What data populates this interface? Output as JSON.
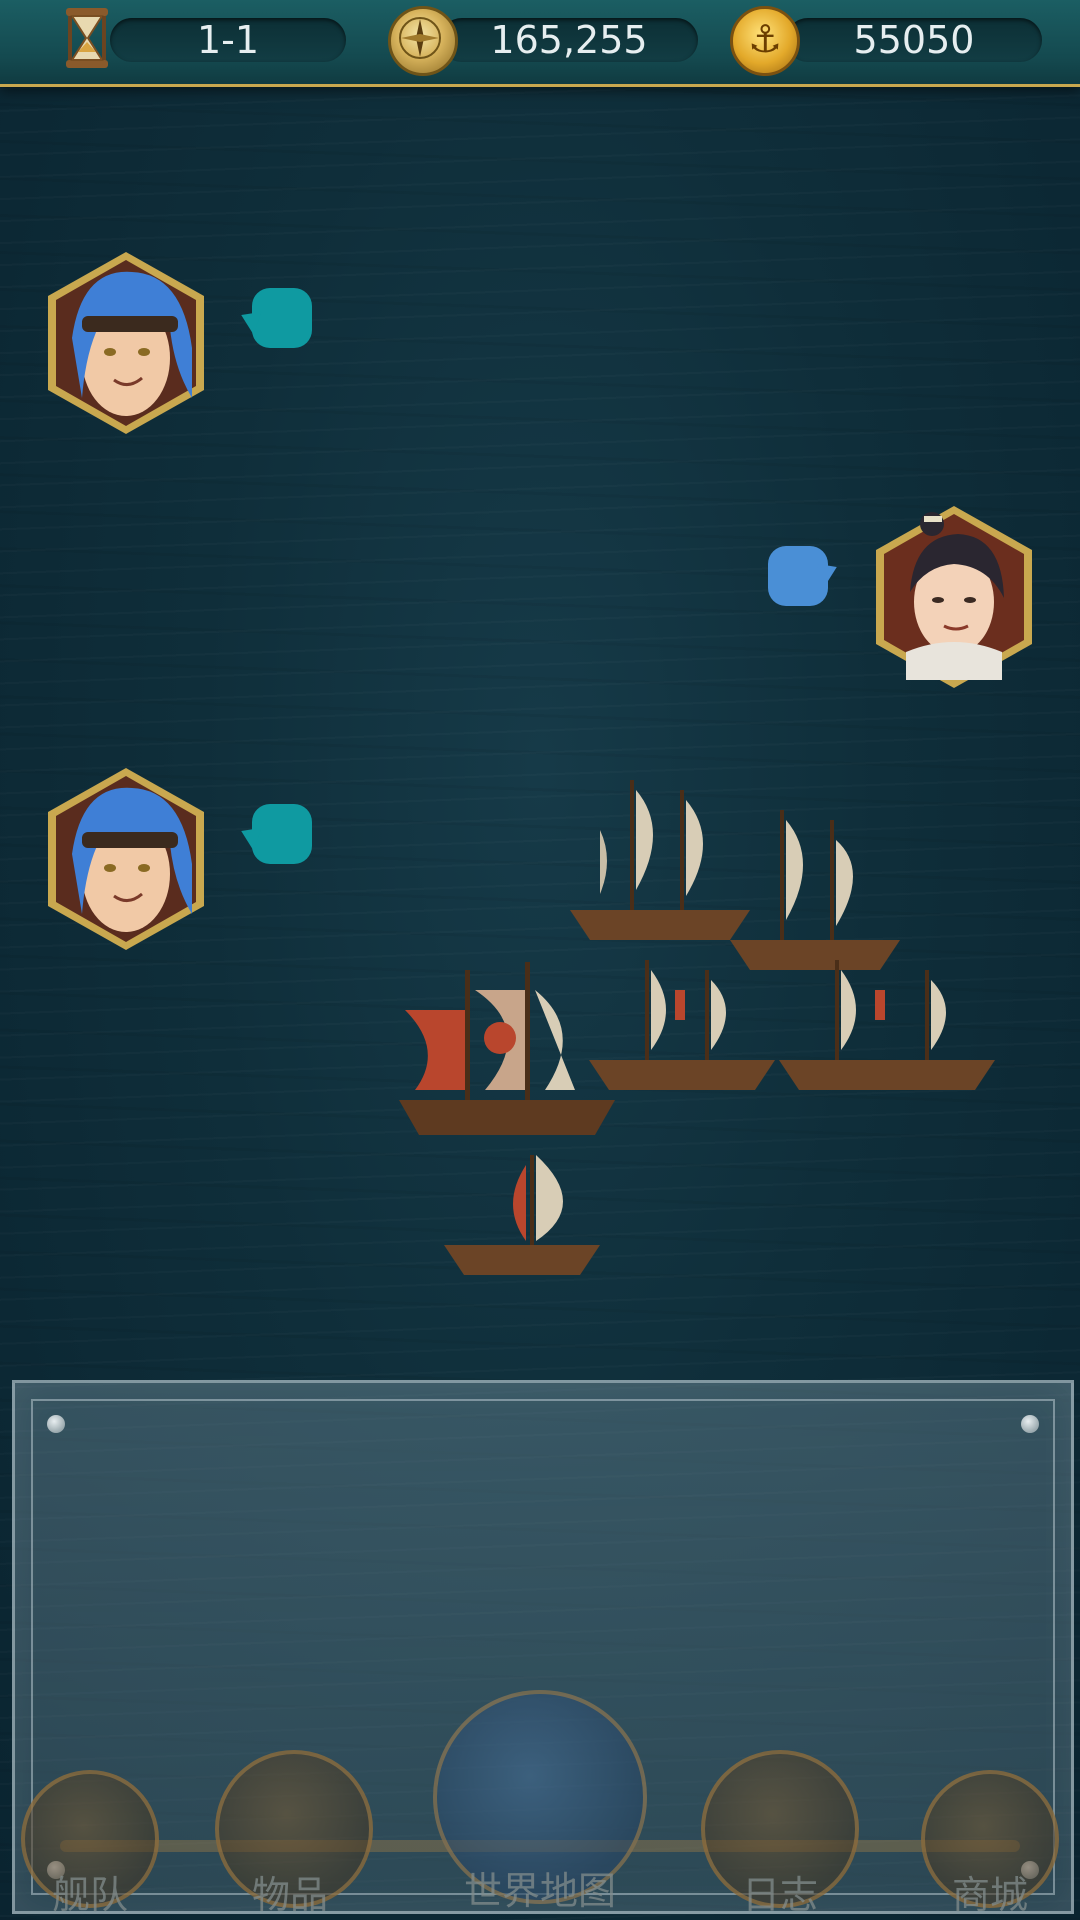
{
  "topbar": {
    "stage": "1-1",
    "exploration": "165,255",
    "gold": "55050"
  },
  "icons": {
    "hourglass": "hourglass-icon",
    "compass": "compass-icon",
    "coin": "anchor-coin-icon"
  },
  "colors": {
    "bubble_teal": "#0f9aa1",
    "bubble_blue": "#4a8fd6",
    "frame_gold": "#c9a84f"
  },
  "nav": {
    "items": [
      {
        "label": "舰队"
      },
      {
        "label": "物品"
      },
      {
        "label": "世界地图"
      },
      {
        "label": "日志"
      },
      {
        "label": "商城"
      }
    ]
  }
}
